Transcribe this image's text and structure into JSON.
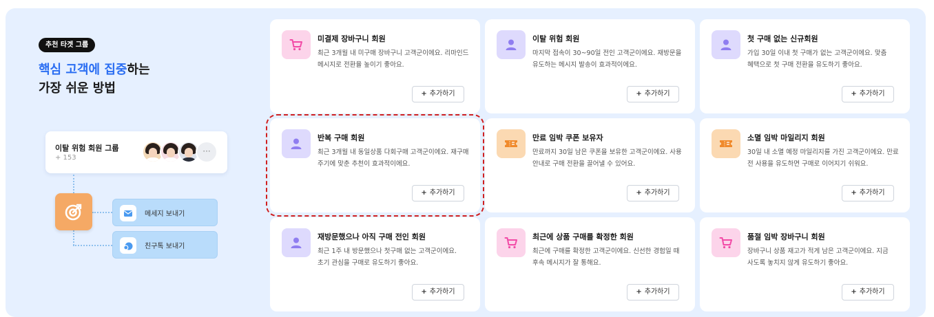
{
  "intro": {
    "badge": "추천 타겟 그룹",
    "headline_highlight": "핵심 고객에 집중",
    "headline_rest1": "하는",
    "headline_line2": "가장 쉬운 방법"
  },
  "group": {
    "title": "이탈 위험 회원 그룹",
    "count": "+ 153",
    "more": "···"
  },
  "actions": [
    {
      "label": "메세지 보내기",
      "icon": "mail-icon"
    },
    {
      "label": "친구톡 보내기",
      "icon": "chat-bubble-icon"
    }
  ],
  "add_label": "추가하기",
  "cards": [
    {
      "title": "미결제 장바구니 회원",
      "desc": "최근 3개월 내 미구매 장바구니 고객군이에요. 리마인드 메시지로 전환율 높이기 좋아요.",
      "icon": "cart-icon",
      "icon_bg": "#fcd4ea"
    },
    {
      "title": "이탈 위험 회원",
      "desc": "마지막 접속이 30~90일 전인 고객군이에요. 재방문을 유도하는 메시지 발송이 효과적이에요.",
      "icon": "user-icon",
      "icon_bg": "#dedafd"
    },
    {
      "title": "첫 구매 없는 신규회원",
      "desc": "가입 30일 이내 첫 구매가 없는 고객군이에요. 맞춤 혜택으로 첫 구매 전환을 유도하기 좋아요.",
      "icon": "user-icon",
      "icon_bg": "#dedafd"
    },
    {
      "title": "반복 구매 회원",
      "desc": "최근 3개월 내 동일상품 다회구매 고객군이에요. 재구매 주기에 맞춘 추천이 효과적이에요.",
      "icon": "user-icon",
      "icon_bg": "#dedafd",
      "selected": true
    },
    {
      "title": "만료 임박 쿠폰 보유자",
      "desc": "만료까지 30일 남은 쿠폰을 보유한 고객군이에요. 사용 안내로 구매 전환을 끌어낼 수 있어요.",
      "icon": "ticket-icon",
      "icon_bg": "#fbd9b2"
    },
    {
      "title": "소멸 임박 마일리지 회원",
      "desc": "30일 내 소멸 예정 마일리지를 가진 고객군이에요. 만료 전 사용을 유도하면 구매로 이어지기 쉬워요.",
      "icon": "ticket-icon",
      "icon_bg": "#fbd9b2"
    },
    {
      "title": "재방문했으나 아직 구매 전인 회원",
      "desc": "최근 1주 내 방문했으나 첫구매 없는 고객군이에요. 초기 관심을 구매로 유도하기 좋아요.",
      "icon": "user-icon",
      "icon_bg": "#dedafd"
    },
    {
      "title": "최근에 상품 구매를 확정한 회원",
      "desc": "최근에 구매를 확정한 고객군이에요. 신선한 경험일 때 후속 메시지가 잘 통해요.",
      "icon": "cart-icon",
      "icon_bg": "#fcd4ea"
    },
    {
      "title": "품절 임박 장바구니 회원",
      "desc": "장바구니 상품 재고가 적게 남은 고객군이에요. 지금 사도록 놓치지 않게 유도하기 좋아요.",
      "icon": "cart-icon",
      "icon_bg": "#fcd4ea"
    }
  ],
  "colors": {
    "panel_bg": "#e6f0ff",
    "highlight": "#2b6ef2",
    "target_box": "#f5a965",
    "action_bg": "#b9dcfb",
    "selected_outline": "#d02020"
  }
}
